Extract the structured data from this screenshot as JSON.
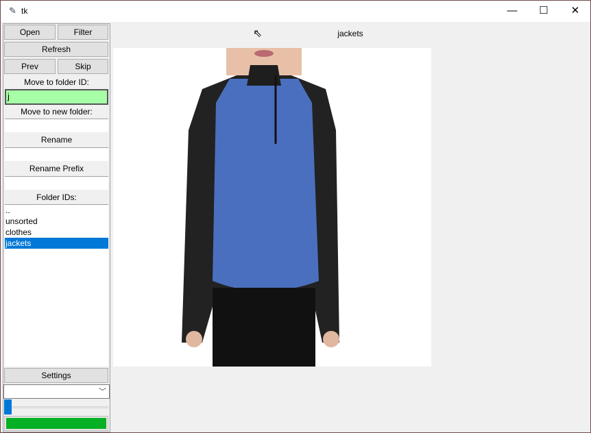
{
  "window": {
    "title": "tk",
    "minimize": "—",
    "maximize": "☐",
    "close": "✕"
  },
  "sidebar": {
    "open_label": "Open",
    "filter_label": "Filter",
    "refresh_label": "Refresh",
    "prev_label": "Prev",
    "skip_label": "Skip",
    "move_folder_id_label": "Move to folder ID:",
    "move_folder_id_value": "j",
    "move_new_folder_label": "Move to new folder:",
    "move_new_folder_value": "",
    "rename_label": "Rename",
    "rename_value": "",
    "rename_prefix_label": "Rename Prefix",
    "rename_prefix_value": "",
    "folder_ids_label": "Folder IDs:",
    "folders": [
      "..",
      "unsorted",
      "clothes",
      "jackets"
    ],
    "selected_folder": "jackets",
    "settings_label": "Settings",
    "dropdown_value": "",
    "slider_value": 0,
    "progress_percent": 100
  },
  "main": {
    "title": "jackets"
  },
  "colors": {
    "accent": "#0078d7",
    "entry_active": "#a6ffa6",
    "progress": "#06b025"
  }
}
